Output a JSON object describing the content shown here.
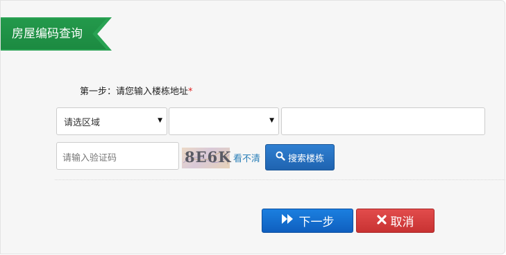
{
  "header": {
    "title": "房屋编码查询"
  },
  "step": {
    "label": "第一步：请您输入楼栋地址",
    "required_mark": "*"
  },
  "selects": [
    {
      "value": "请选区域"
    },
    {
      "value": ""
    }
  ],
  "address_input": {
    "value": ""
  },
  "captcha": {
    "placeholder": "请输入验证码",
    "code": "8E6K",
    "refresh_label": "看不清"
  },
  "buttons": {
    "search": "搜索楼栋",
    "next": "下一步",
    "cancel": "取消"
  },
  "icons": {
    "search": "search-icon",
    "next": "forward-icon",
    "cancel": "close-icon"
  },
  "colors": {
    "brand_green": "#1c8a41",
    "primary_blue": "#1f63b0",
    "danger_red": "#c83232",
    "link": "#2a7fb8"
  }
}
